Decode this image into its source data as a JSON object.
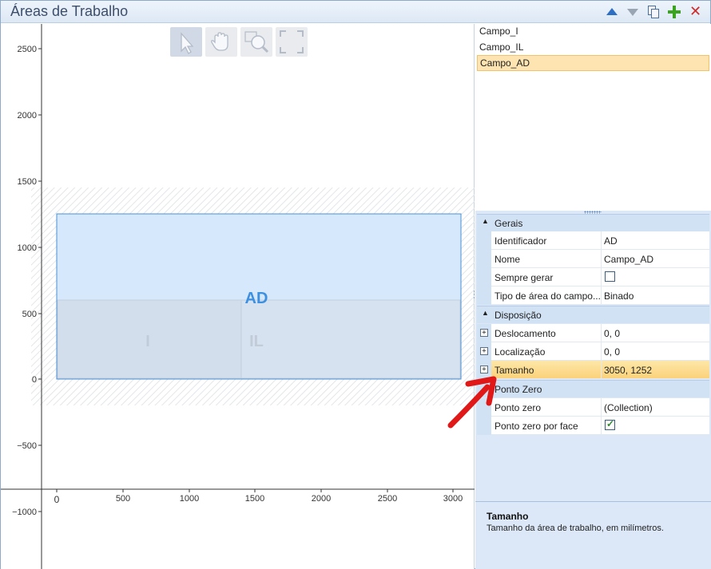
{
  "window": {
    "title": "Áreas de Trabalho"
  },
  "toolbar_icons": [
    "move-up-icon",
    "move-down-icon",
    "copy-icon",
    "add-icon",
    "delete-icon"
  ],
  "canvas": {
    "tools": [
      "pointer-tool-icon",
      "pan-hand-icon",
      "zoom-icon",
      "fit-view-icon"
    ],
    "x_ticks": [
      "0",
      "500",
      "1000",
      "1500",
      "2000",
      "2500",
      "3000"
    ],
    "y_ticks": [
      "2500",
      "2000",
      "1500",
      "1000",
      "500",
      "0",
      "−500",
      "−1000"
    ],
    "area_labels": {
      "main": "AD",
      "left": "I",
      "right": "IL"
    }
  },
  "areas_list": [
    "Campo_I",
    "Campo_IL",
    "Campo_AD"
  ],
  "selected_area": "Campo_AD",
  "properties": {
    "gerais": {
      "label": "Gerais",
      "identificador": {
        "name": "Identificador",
        "value": "AD"
      },
      "nome": {
        "name": "Nome",
        "value": "Campo_AD"
      },
      "sempre_gerar": {
        "name": "Sempre gerar",
        "checked": false
      },
      "tipo_area": {
        "name": "Tipo de área do campo...",
        "value": "Binado"
      }
    },
    "disposicao": {
      "label": "Disposição",
      "deslocamento": {
        "name": "Deslocamento",
        "value": "0, 0"
      },
      "localizacao": {
        "name": "Localização",
        "value": "0, 0"
      },
      "tamanho": {
        "name": "Tamanho",
        "value": "3050, 1252"
      }
    },
    "ponto_zero": {
      "label": "Ponto Zero",
      "ponto_zero": {
        "name": "Ponto zero",
        "value": "(Collection)"
      },
      "por_face": {
        "name": "Ponto zero por face",
        "checked": true
      }
    }
  },
  "help": {
    "title": "Tamanho",
    "description": "Tamanho da área de trabalho, em milímetros."
  },
  "colors": {
    "accent": "#2e6fc4",
    "selection": "#fde4b0",
    "area_fill": "#d6e8fb",
    "area_stroke": "#4a8fd6",
    "annotation_arrow": "#e01818"
  }
}
